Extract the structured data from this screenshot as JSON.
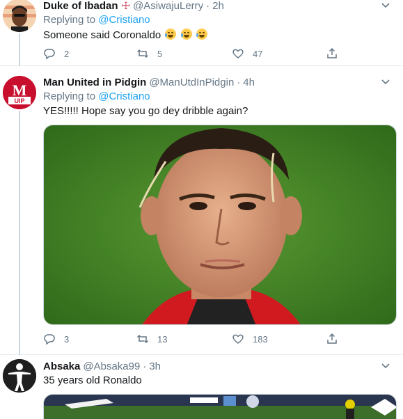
{
  "tweets": [
    {
      "name": "Duke of Ibadan",
      "handle": "@AsiwajuLerry",
      "time": "2h",
      "replying_label": "Replying to",
      "replying_to": "@Cristiano",
      "text": "Someone said Coronaldo",
      "emoji_names": [
        "loudly-crying-face",
        "face-with-tears-of-joy",
        "face-with-tears-of-joy"
      ],
      "replies": "2",
      "retweets": "5",
      "likes": "47"
    },
    {
      "name": "Man United in Pidgin",
      "handle": "@ManUtdInPidgin",
      "time": "4h",
      "replying_label": "Replying to",
      "replying_to": "@Cristiano",
      "text": "YES!!!!! Hope say you go dey dribble again?",
      "avatar_text_top": "M",
      "avatar_text_bottom": "UIP",
      "replies": "3",
      "retweets": "13",
      "likes": "183"
    },
    {
      "name": "Absaka",
      "handle": "@Absaka99",
      "time": "3h",
      "text": "35 years old Ronaldo"
    }
  ],
  "colors": {
    "accent": "#1da1f2",
    "muted": "#657786",
    "border": "#e6ecf0",
    "pitch_green": "#4c8a2a",
    "jersey_red": "#d11a1f"
  }
}
